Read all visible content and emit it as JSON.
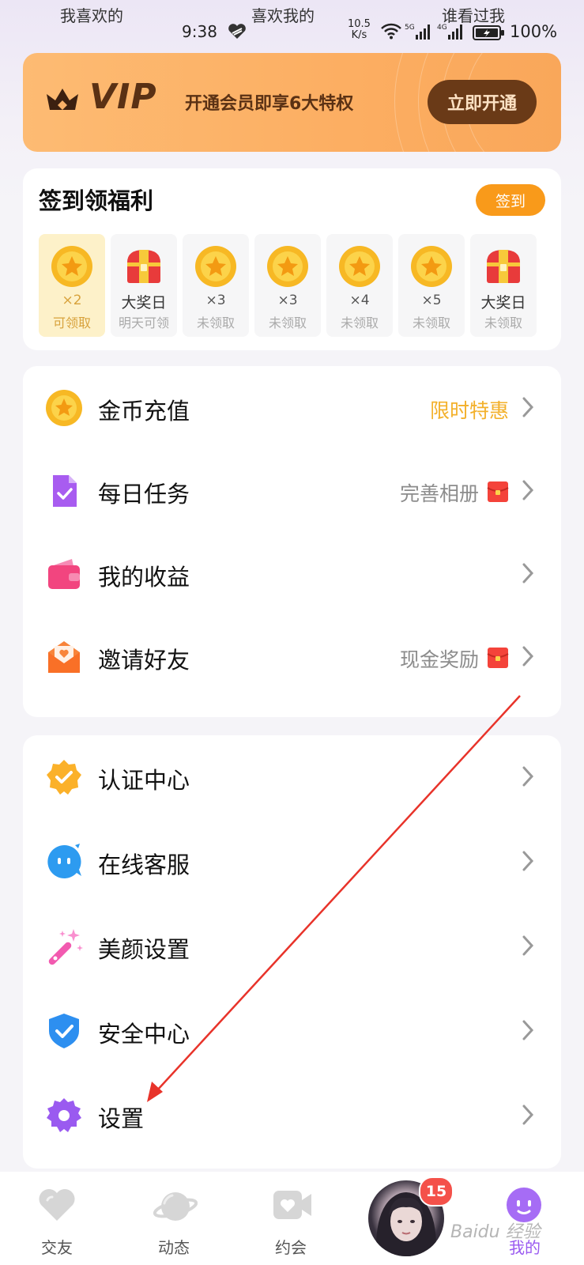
{
  "top_tabs": [
    "我喜欢的",
    "喜欢我的",
    "谁看过我"
  ],
  "status_bar": {
    "time": "9:38",
    "net_speed_value": "10.5",
    "net_speed_unit": "K/s",
    "battery": "100%",
    "signal_labels": [
      "5G",
      "4G"
    ]
  },
  "vip": {
    "logo": "VIP",
    "description": "开通会员即享6大特权",
    "button": "立即开通"
  },
  "sign_in": {
    "title": "签到领福利",
    "button": "签到",
    "days": [
      {
        "type": "coin",
        "value": "×2",
        "status": "可领取",
        "active": true
      },
      {
        "type": "gift",
        "value": "大奖日",
        "status": "明天可领",
        "active": false
      },
      {
        "type": "coin",
        "value": "×3",
        "status": "未领取",
        "active": false
      },
      {
        "type": "coin",
        "value": "×3",
        "status": "未领取",
        "active": false
      },
      {
        "type": "coin",
        "value": "×4",
        "status": "未领取",
        "active": false
      },
      {
        "type": "coin",
        "value": "×5",
        "status": "未领取",
        "active": false
      },
      {
        "type": "gift",
        "value": "大奖日",
        "status": "未领取",
        "active": false
      }
    ]
  },
  "menu_group_1": [
    {
      "label": "金币充值",
      "right": "限时特惠",
      "icon": "coin-icon"
    },
    {
      "label": "每日任务",
      "right": "完善相册",
      "icon": "task-icon"
    },
    {
      "label": "我的收益",
      "right": "",
      "icon": "wallet-icon"
    },
    {
      "label": "邀请好友",
      "right": "现金奖励",
      "icon": "invite-icon"
    }
  ],
  "menu_group_2": [
    {
      "label": "认证中心",
      "icon": "verify-badge-icon"
    },
    {
      "label": "在线客服",
      "icon": "chat-bubble-icon"
    },
    {
      "label": "美颜设置",
      "icon": "magic-wand-icon"
    },
    {
      "label": "安全中心",
      "icon": "shield-icon"
    },
    {
      "label": "设置",
      "icon": "gear-icon"
    }
  ],
  "bottom_nav": {
    "items": [
      "交友",
      "动态",
      "约会",
      "我的"
    ],
    "badge_count": "15",
    "watermark": "Baidu 经验"
  },
  "colors": {
    "accent_orange": "#f99a1a",
    "active_purple": "#9a5af0",
    "annotation_red": "#e8332a"
  }
}
